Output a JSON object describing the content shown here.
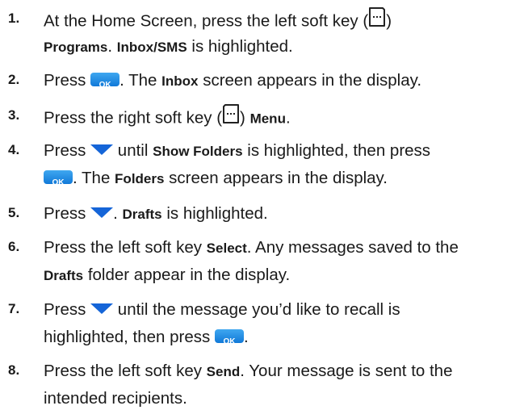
{
  "header_clip": "",
  "steps": [
    {
      "num": "1.",
      "l1": {
        "a": "At the Home Screen, press the left soft key (",
        "b": ")"
      },
      "l2": {
        "a": "Programs",
        "b": ". ",
        "c": "Inbox/SMS",
        "d": " is highlighted."
      }
    },
    {
      "num": "2.",
      "l1": {
        "a": "Press ",
        "ok": "OK",
        "b": ". The ",
        "c": "Inbox",
        "d": " screen appears in the display."
      }
    },
    {
      "num": "3.",
      "l1": {
        "a": "Press the right soft key (",
        "b": ") ",
        "c": "Menu",
        "d": "."
      }
    },
    {
      "num": "4.",
      "l1": {
        "a": "Press ",
        "b": " until ",
        "c": "Show Folders",
        "d": " is highlighted, then press"
      },
      "l2": {
        "ok": "OK",
        "a": ". The ",
        "b": "Folders",
        "c": " screen appears in the display."
      }
    },
    {
      "num": "5.",
      "l1": {
        "a": "Press ",
        "b": ". ",
        "c": "Drafts",
        "d": " is highlighted."
      }
    },
    {
      "num": "6.",
      "l1": {
        "a": "Press the left soft key ",
        "b": "Select",
        "c": ". Any messages saved to the"
      },
      "l2": {
        "a": "Drafts",
        "b": " folder appear in the display."
      }
    },
    {
      "num": "7.",
      "l1": {
        "a": "Press ",
        "b": " until the message you’d like to recall is"
      },
      "l2": {
        "a": "highlighted, then press ",
        "ok": "OK",
        "b": "."
      }
    },
    {
      "num": "8.",
      "l1": {
        "a": "Press the left soft key ",
        "b": "Send",
        "c": ". Your message is sent to the"
      },
      "l2": {
        "a": "intended recipients."
      }
    }
  ],
  "icons": {
    "left_softkey": "left-soft-key-icon",
    "right_softkey": "right-soft-key-icon",
    "ok_key": "ok-key-icon",
    "down_arrow": "navigation-down-icon"
  },
  "colors": {
    "ok_key": "#1a84e2",
    "down_arrow": "#1565d8"
  }
}
